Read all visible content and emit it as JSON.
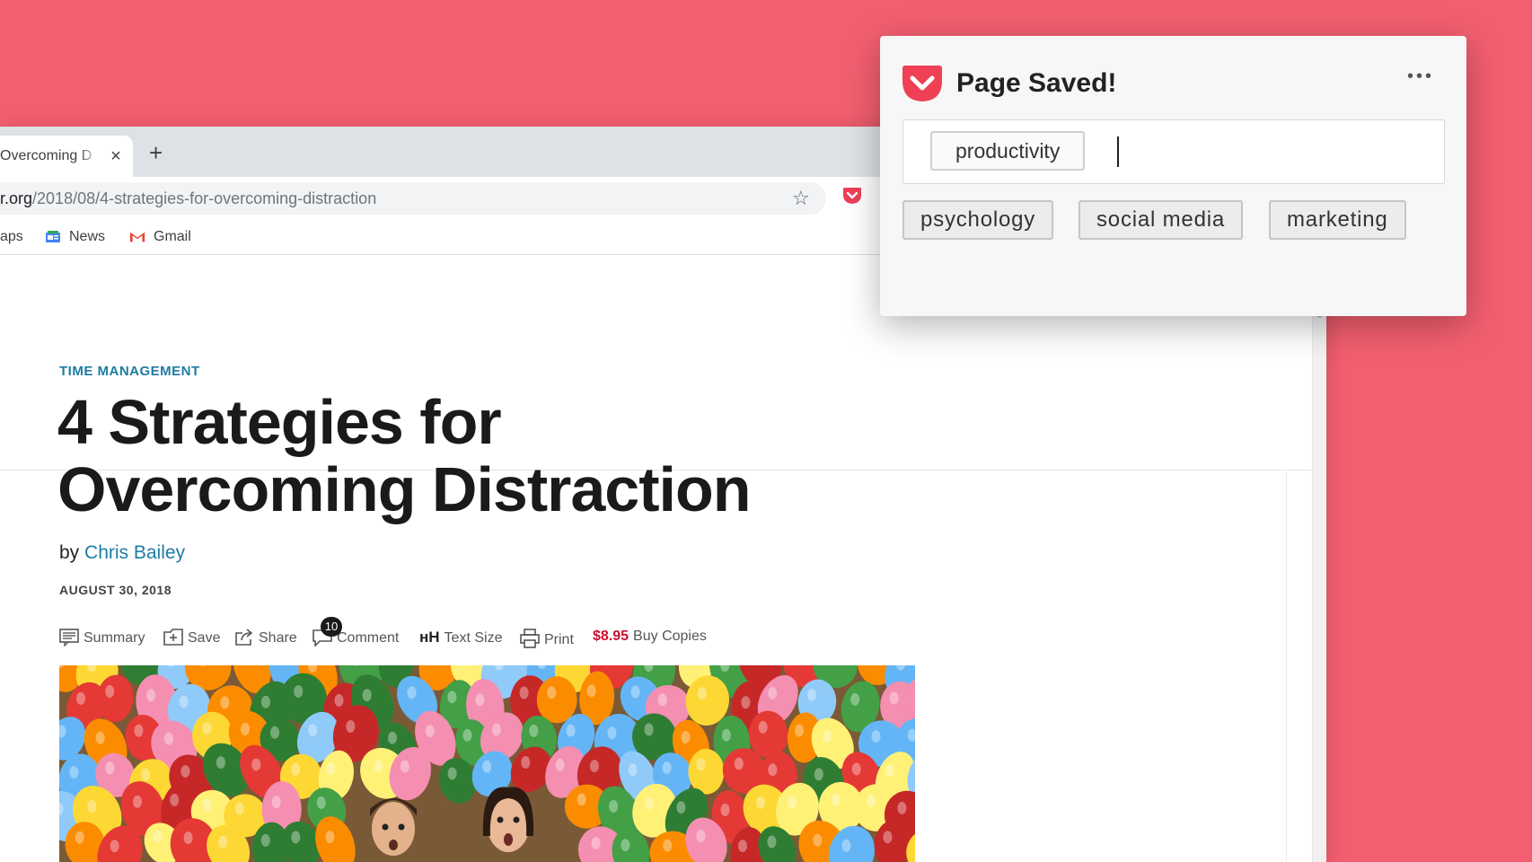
{
  "browser": {
    "tab_title": "Overcoming D",
    "tab_close": "×",
    "new_tab": "+",
    "url_host": "r.org",
    "url_path": "/2018/08/4-strategies-for-overcoming-distraction",
    "bookmarks": [
      "aps",
      "News",
      "Gmail"
    ]
  },
  "article": {
    "topic": "TIME MANAGEMENT",
    "headline_line1": "4 Strategies for",
    "headline_line2": "Overcoming Distraction",
    "by": "by",
    "author": "Chris Bailey",
    "date": "AUGUST 30, 2018",
    "actions": {
      "summary": "Summary",
      "save": "Save",
      "share": "Share",
      "comment": "Comment",
      "comment_count": "10",
      "text_size_glyph": "ʜH",
      "text_size": "Text Size",
      "print": "Print",
      "price": "$8.95",
      "buy": "Buy Copies"
    }
  },
  "popup": {
    "title": "Page Saved!",
    "menu": "•••",
    "tags": [
      "productivity"
    ],
    "suggested_tags": [
      "psychology",
      "social media",
      "marketing"
    ]
  },
  "colors": {
    "background": "#f35f70",
    "pocket_red": "#ef4056",
    "link_blue": "#1e7ca2",
    "price_red": "#c8102e"
  }
}
